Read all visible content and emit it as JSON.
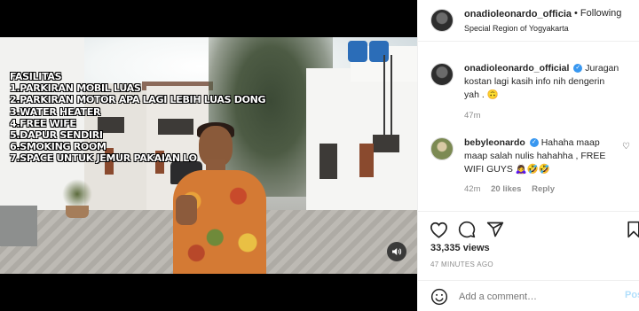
{
  "post": {
    "owner": "onadioleonardo_official",
    "owner_truncated": "onadioleonardo_officia",
    "follow_label": "Following",
    "follow_separator": "•",
    "location": "Special Region of Yogyakarta"
  },
  "video": {
    "overlay_lines": [
      "FASILITAS",
      "1.PARKIRAN MOBIL LUAS",
      "2.PARKIRAN MOTOR APA LAGI LEBIH LUAS DONG",
      "3.WATER HEATER",
      "4.FREE WIFE",
      "5.DAPUR SENDIRI",
      "6.SMOKING ROOM",
      "7.SPACE UNTUK JEMUR PAKAIAN LO"
    ]
  },
  "caption": {
    "username": "onadioleonardo_official",
    "text": "Juragan kostan lagi kasih info nih dengerin yah . 🙃",
    "time": "47m"
  },
  "comments": [
    {
      "username": "bebyleonardo",
      "text": "Hahaha maap maap salah nulis hahahha , FREE WIFI GUYS 🙇‍♀️🤣🤣",
      "time": "42m",
      "likes": "20 likes",
      "reply": "Reply"
    }
  ],
  "stats": {
    "views": "33,335 views",
    "time_ago": "47 MINUTES AGO"
  },
  "add_comment": {
    "placeholder": "Add a comment…",
    "post_label": "Post"
  },
  "colors": {
    "verified": "#3897f0",
    "muted_text": "#8e8e8e",
    "post_button": "#b2dffc",
    "border": "#efefef"
  }
}
